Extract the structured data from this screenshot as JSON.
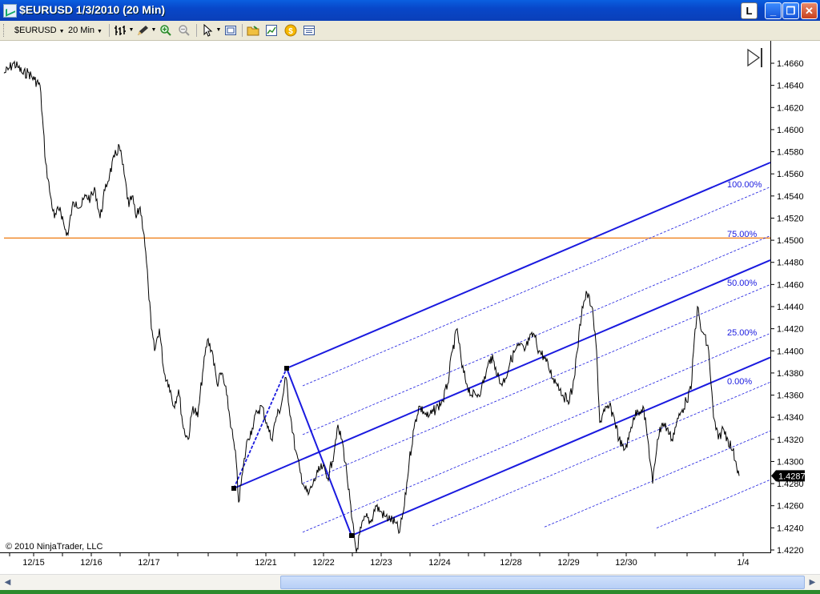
{
  "window": {
    "title": "$EURUSD  1/3/2010 (20 Min)",
    "l_button": "L",
    "min_button": "_",
    "max_button": "❐",
    "close_button": "✕"
  },
  "toolbar": {
    "instrument": "$EURUSD",
    "interval": "20 Min",
    "icons": [
      "bar-style-icon",
      "drawing-pencil-icon",
      "zoom-in-icon",
      "zoom-out-icon",
      "pointer-icon",
      "data-box-icon",
      "folder-icon",
      "indicators-icon",
      "strategies-icon",
      "properties-icon"
    ]
  },
  "chart": {
    "copyright": "© 2010 NinjaTrader, LLC",
    "last_price_label": "1.4287",
    "colors": {
      "price": "#000000",
      "fib_lines": "#1a1adf",
      "horizontal_line": "#f08a2c",
      "last_price_bg": "#000000"
    }
  },
  "chart_data": {
    "type": "line",
    "title": "",
    "ylim": [
      1.4205,
      1.467
    ],
    "y_ticks": [
      "1.4660",
      "1.4640",
      "1.4620",
      "1.4600",
      "1.4580",
      "1.4560",
      "1.4540",
      "1.4520",
      "1.4500",
      "1.4480",
      "1.4460",
      "1.4440",
      "1.4420",
      "1.4400",
      "1.4380",
      "1.4360",
      "1.4340",
      "1.4320",
      "1.4300",
      "1.4280",
      "1.4260",
      "1.4240",
      "1.4220"
    ],
    "x_tick_labels": [
      "12/15",
      "12/16",
      "12/17",
      "12/21",
      "12/22",
      "12/23",
      "12/24",
      "12/28",
      "12/29",
      "12/30",
      "1/4"
    ],
    "horizontal_line": 1.4502,
    "last_price": 1.4287,
    "fib_channel": {
      "levels": [
        "100.00%",
        "75.00%",
        "50.00%",
        "25.00%",
        "0.00%"
      ]
    },
    "series": [
      {
        "x": [
          0,
          5,
          12,
          18,
          24,
          30,
          38,
          45,
          52,
          58,
          63,
          70,
          76,
          80,
          85,
          90,
          96,
          102,
          108,
          114,
          120,
          126,
          132,
          138,
          144,
          150,
          156,
          160,
          165,
          170,
          175,
          180,
          184,
          188,
          194,
          200,
          206,
          212,
          218,
          224,
          230,
          236,
          242,
          248,
          254,
          260,
          266,
          272,
          278,
          284,
          290,
          293,
          298,
          304,
          310,
          316,
          322,
          328,
          334,
          340,
          346,
          352,
          358,
          364,
          370,
          376,
          380,
          386,
          392,
          398,
          404,
          410,
          416,
          422,
          428,
          434,
          440,
          446,
          452,
          458,
          464,
          470,
          476,
          482,
          488,
          494,
          500,
          506,
          512,
          518,
          524,
          530,
          536,
          542,
          548,
          554,
          560,
          566,
          572,
          578,
          584,
          590,
          596,
          602,
          608,
          614,
          620,
          626,
          632,
          638,
          644,
          650,
          656,
          662,
          668,
          674,
          680,
          686,
          692,
          698,
          704,
          710,
          716,
          722,
          728,
          734,
          740,
          744,
          750,
          756,
          762,
          768,
          774,
          780,
          786,
          792,
          798,
          804,
          810,
          816,
          822,
          828,
          834,
          840,
          846,
          852,
          858,
          862,
          866,
          870,
          874,
          880,
          886,
          892,
          898,
          904,
          910,
          914,
          918
        ],
        "y": [
          1.4651,
          1.4654,
          1.466,
          1.4656,
          1.465,
          1.4652,
          1.4645,
          1.464,
          1.457,
          1.454,
          1.452,
          1.453,
          1.451,
          1.4505,
          1.453,
          1.4535,
          1.453,
          1.454,
          1.4538,
          1.4545,
          1.452,
          1.4545,
          1.456,
          1.4575,
          1.4585,
          1.456,
          1.453,
          1.454,
          1.452,
          1.453,
          1.4505,
          1.446,
          1.442,
          1.44,
          1.442,
          1.438,
          1.437,
          1.435,
          1.4365,
          1.433,
          1.432,
          1.435,
          1.434,
          1.438,
          1.441,
          1.44,
          1.437,
          1.438,
          1.436,
          1.433,
          1.43,
          1.4263,
          1.429,
          1.432,
          1.433,
          1.4345,
          1.435,
          1.4335,
          1.432,
          1.434,
          1.435,
          1.4376,
          1.434,
          1.431,
          1.429,
          1.4275,
          1.427,
          1.428,
          1.429,
          1.4295,
          1.4285,
          1.43,
          1.433,
          1.432,
          1.429,
          1.425,
          1.4218,
          1.424,
          1.425,
          1.4245,
          1.426,
          1.4255,
          1.425,
          1.4248,
          1.4245,
          1.4236,
          1.426,
          1.43,
          1.433,
          1.435,
          1.4345,
          1.434,
          1.4345,
          1.435,
          1.4355,
          1.437,
          1.44,
          1.442,
          1.4385,
          1.437,
          1.436,
          1.436,
          1.4365,
          1.438,
          1.4395,
          1.4385,
          1.437,
          1.4375,
          1.439,
          1.44,
          1.4405,
          1.44,
          1.441,
          1.4415,
          1.44,
          1.4395,
          1.4385,
          1.4375,
          1.437,
          1.436,
          1.4355,
          1.4365,
          1.44,
          1.444,
          1.4452,
          1.444,
          1.44,
          1.4335,
          1.4345,
          1.435,
          1.434,
          1.432,
          1.431,
          1.432,
          1.434,
          1.4345,
          1.435,
          1.432,
          1.428,
          1.432,
          1.4335,
          1.433,
          1.432,
          1.4335,
          1.4345,
          1.4355,
          1.4365,
          1.441,
          1.444,
          1.442,
          1.4415,
          1.44,
          1.434,
          1.432,
          1.433,
          1.432,
          1.431,
          1.43,
          1.4287
        ]
      }
    ]
  }
}
